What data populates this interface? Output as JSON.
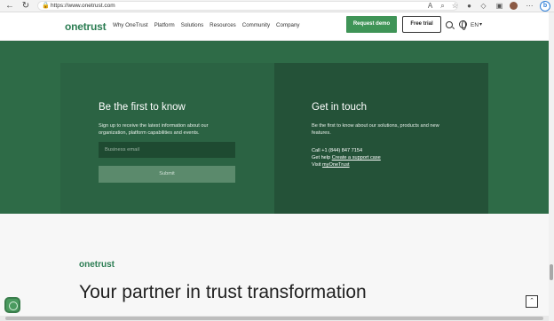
{
  "browser": {
    "url": "https://www.onetrust.com"
  },
  "header": {
    "logo": "onetrust",
    "nav": [
      "Why OneTrust",
      "Platform",
      "Solutions",
      "Resources",
      "Community",
      "Company"
    ],
    "request_demo": "Request demo",
    "free_trial": "Free trial",
    "language": "EN"
  },
  "newsletter": {
    "heading": "Be the first to know",
    "text": "Sign up to receive the latest information about our organization, platform capabilities and events.",
    "email_placeholder": "Business email",
    "submit": "Submit"
  },
  "contact": {
    "heading": "Get in touch",
    "text": "Be the first to know about our solutions, products and new features.",
    "call_label": "Call",
    "call_value": "+1 (844) 847 7154",
    "help_label": "Get help",
    "help_link": "Create a support case",
    "visit_label": "Visit",
    "visit_link": "myOneTrust"
  },
  "lower": {
    "logo": "onetrust",
    "tagline": "Your partner in trust transformation"
  },
  "colors": {
    "brand_green": "#2c7d53",
    "band_green": "#2e6b47",
    "panel_dark": "#245238",
    "button_green": "#3f9457"
  }
}
